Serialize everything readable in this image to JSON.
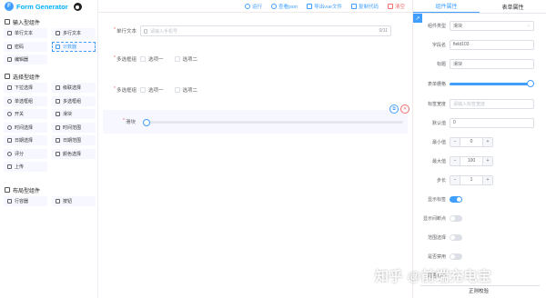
{
  "app": {
    "logo_mark": "F",
    "title": "Form Generator"
  },
  "left": {
    "groups": [
      {
        "title": "输入型组件",
        "items": [
          "单行文本",
          "多行文本",
          "密码",
          "计数器",
          "编辑器"
        ]
      },
      {
        "title": "选择型组件",
        "items": [
          "下拉选择",
          "级联选择",
          "单选框组",
          "多选框组",
          "开关",
          "滑块",
          "时间选择",
          "时间范围",
          "日期选择",
          "日期范围",
          "评分",
          "颜色选择",
          "上传"
        ]
      },
      {
        "title": "布局型组件",
        "items": [
          "行容器",
          "按钮"
        ]
      }
    ],
    "active_item": "计数器"
  },
  "toolbar": {
    "run": "运行",
    "view_json": "查看json",
    "export_vue": "导出vue文件",
    "copy_code": "复制代码",
    "clear": "清空"
  },
  "canvas": {
    "text_field": {
      "label": "单行文本",
      "placeholder": "请输入手机号",
      "counter": "0/11"
    },
    "checkbox_group_1": {
      "label": "多选框组",
      "options": [
        "选项一",
        "选项二"
      ]
    },
    "checkbox_group_2": {
      "label": "多选框组",
      "options": [
        "选项一",
        "选项二"
      ]
    },
    "slider": {
      "label": "滑块",
      "value": 0
    }
  },
  "right": {
    "tabs": [
      "组件属性",
      "表单属性"
    ],
    "active_tab": "组件属性",
    "link_icon": "link-icon",
    "props": {
      "type": {
        "label": "组件类型",
        "value": "滑块"
      },
      "field": {
        "label": "字段名",
        "value": "field103"
      },
      "title": {
        "label": "标题",
        "value": "滑块"
      },
      "grid": {
        "label": "表单栅格",
        "fraction": 1.0
      },
      "label_width": {
        "label": "标签宽度",
        "placeholder": "请输入标签宽度"
      },
      "default": {
        "label": "默认值",
        "value": "0"
      },
      "min": {
        "label": "最小值",
        "value": "0"
      },
      "max": {
        "label": "最大值",
        "value": "100"
      },
      "step": {
        "label": "步长",
        "value": "1"
      },
      "show_label": {
        "label": "显示标签",
        "on": true
      },
      "show_stops": {
        "label": "显示间断点",
        "on": false
      },
      "range": {
        "label": "范围选择",
        "on": false
      },
      "disabled": {
        "label": "是否禁用",
        "on": false
      },
      "required": {
        "label": "是否必填"
      }
    },
    "divider": "正则校验"
  },
  "watermark": "知乎 @前端充电宝",
  "colors": {
    "primary": "#409eff",
    "danger": "#f56c6c",
    "logo_text": "#00afff"
  }
}
